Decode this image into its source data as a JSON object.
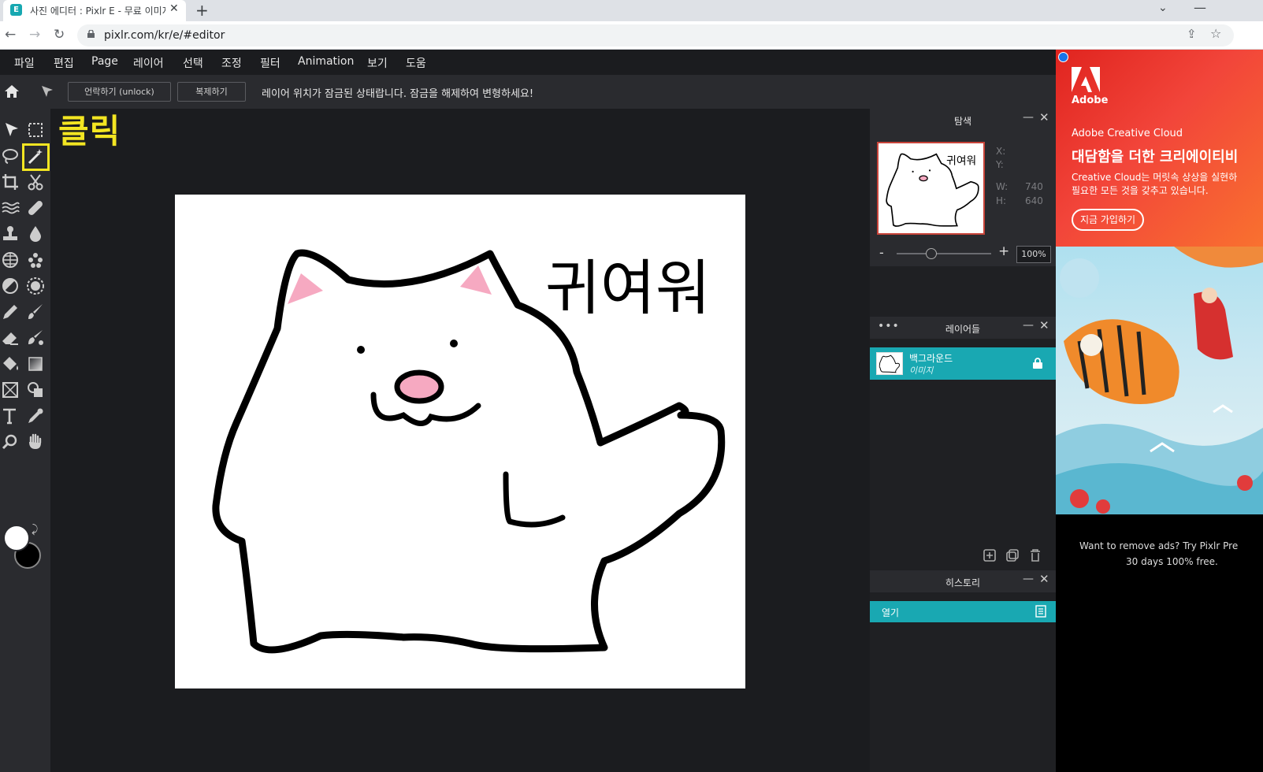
{
  "browser": {
    "tab_title": "사진 에디터 : Pixlr E - 무료 이미지 에디터",
    "tab_favicon": "E",
    "new_tab": "+",
    "url": "pixlr.com/kr/e/#editor"
  },
  "menu": [
    "파일",
    "편집",
    "Page",
    "레이어",
    "선택",
    "조정",
    "필터",
    "Animation",
    "보기",
    "도움"
  ],
  "options": {
    "unlock_label": "언락하기 (unlock)",
    "duplicate_label": "복제하기",
    "message": "레이어 위치가 잠금된 상태랍니다. 잠금을 해제하여 변형하세요!"
  },
  "annotation": {
    "text": "클릭",
    "color": "#f3e522"
  },
  "canvas": {
    "text": "귀여워"
  },
  "navigator": {
    "title": "탐색",
    "x_label": "X:",
    "y_label": "Y:",
    "w_label": "W:",
    "h_label": "H:",
    "w_value": "740",
    "h_value": "640",
    "zoom": "100%",
    "thumb_text": "귀여워"
  },
  "layers": {
    "title": "레이어들",
    "items": [
      {
        "name": "백그라운드",
        "type": "이미지"
      }
    ]
  },
  "history": {
    "title": "히스토리",
    "items": [
      {
        "label": "열기"
      }
    ]
  },
  "ad": {
    "brand": "Adobe",
    "product": "Adobe Creative Cloud",
    "headline": "대담함을 더한 크리에이티비",
    "body1": "Creative Cloud는 머릿속 상상을 실현하",
    "body2": "필요한 모든 것을 갖추고 있습니다.",
    "cta": "지금 가입하기",
    "remove1": "Want to remove ads? Try Pixlr Pre",
    "remove2": "30 days 100% free."
  },
  "colors": {
    "accent": "#19a8b2",
    "annotation": "#f3e522",
    "app_bg": "#1b1c1f",
    "panel_bg": "#2a2b2f"
  },
  "icons": [
    "home-icon",
    "arrow-select-icon",
    "marquee-icon",
    "lasso-icon",
    "magic-wand-icon",
    "crop-icon",
    "cut-icon",
    "liquify-icon",
    "heal-icon",
    "stamp-icon",
    "blur-icon",
    "sponge-icon",
    "detail-icon",
    "dodge-icon",
    "sharpen-icon",
    "pencil-icon",
    "brush-icon",
    "eraser-icon",
    "color-replace-icon",
    "fill-icon",
    "gradient-icon",
    "shape-rect-icon",
    "shape-icon",
    "text-icon",
    "eyedropper-icon",
    "zoom-icon",
    "hand-icon"
  ]
}
